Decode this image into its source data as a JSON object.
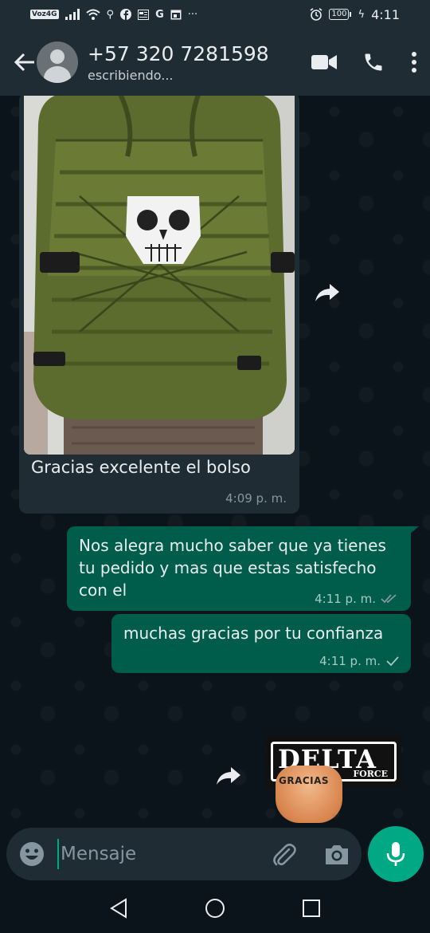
{
  "status_bar": {
    "network_label": "Voz4G",
    "battery": "100",
    "time": "4:11",
    "icons": [
      "signal-icon",
      "wifi-icon",
      "usb-icon",
      "facebook-icon",
      "news-icon",
      "google-icon",
      "calendar-icon",
      "more-dots-icon",
      "alarm-icon",
      "charging-icon"
    ]
  },
  "header": {
    "contact_name": "+57 320 7281598",
    "status": "escribiendo...",
    "icons": [
      "back-arrow-icon",
      "avatar",
      "video-call-icon",
      "phone-icon",
      "menu-icon"
    ]
  },
  "messages": [
    {
      "direction": "incoming",
      "type": "image",
      "caption": "Gracias excelente el bolso",
      "time": "4:09 p. m."
    },
    {
      "direction": "outgoing",
      "text": "Nos alegra mucho saber que ya tienes tu pedido y mas que estas satisfecho con el",
      "time": "4:11 p. m.",
      "ticks": "double"
    },
    {
      "direction": "outgoing",
      "text": "muchas gracias por tu confianza",
      "time": "4:11 p. m.",
      "ticks": "single"
    },
    {
      "direction": "outgoing",
      "type": "sticker",
      "sticker_text": {
        "main": "DELTA",
        "sub": "FORCE",
        "thanks": "GRACIAS"
      }
    }
  ],
  "composer": {
    "placeholder": "Mensaje"
  },
  "colors": {
    "background": "#0b141a",
    "header": "#1f2c34",
    "incoming_bubble": "#1f2c34",
    "outgoing_bubble": "#005c4b",
    "accent": "#00a884"
  }
}
